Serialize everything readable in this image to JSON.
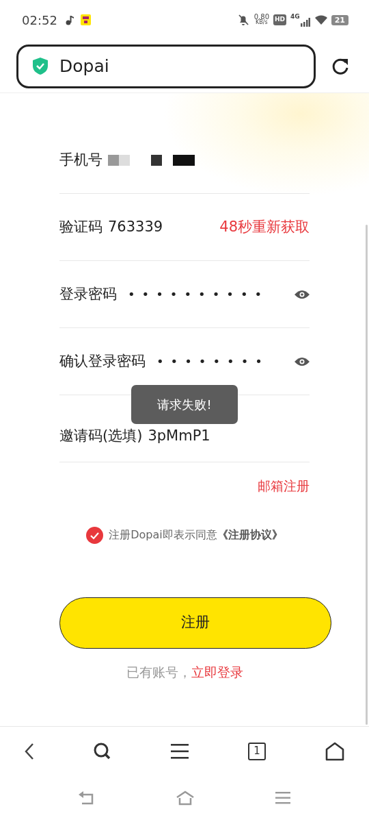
{
  "status_bar": {
    "time": "02:52",
    "net_speed": "0.80",
    "net_unit": "KB/s",
    "hd": "HD",
    "network": "4G",
    "battery": "21"
  },
  "address_bar": {
    "title": "Dopai"
  },
  "form": {
    "fields": [
      {
        "kind": "redacted",
        "label": "手机号"
      },
      {
        "kind": "code",
        "label": "验证码",
        "value": "763339",
        "action": "48秒重新获取"
      },
      {
        "kind": "password",
        "label": "登录密码",
        "value": "••••••••••"
      },
      {
        "kind": "password",
        "label": "确认登录密码",
        "value": "••••••••"
      },
      {
        "kind": "text",
        "label": "邀请码(选填)",
        "value": "3pMmP1"
      }
    ],
    "email_link": "邮箱注册",
    "agreement": {
      "checked": true,
      "text": "注册Dopai即表示同意",
      "link": "《注册协议》"
    },
    "submit": "注册",
    "login_prompt": "已有账号，",
    "login_link": "立即登录"
  },
  "toast": "请求失败!",
  "browser_nav": {
    "tab_count": "1"
  }
}
